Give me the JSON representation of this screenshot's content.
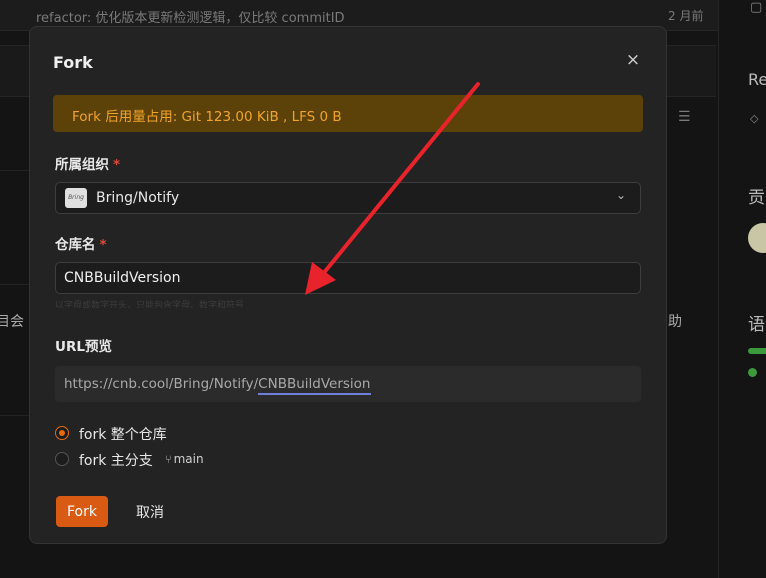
{
  "background": {
    "commit_message": "refactor: 优化版本更新检测逻辑，仅比较 commitID",
    "commit_time": "2 月前",
    "right_heading_1": "Re",
    "right_heading_2": "贡",
    "right_heading_3": "语",
    "left_fragment": "目会",
    "right_fragment": "助"
  },
  "modal": {
    "title": "Fork",
    "close_symbol": "×",
    "usage_banner": "Fork 后用量占用: Git 123.00 KiB , LFS 0 B",
    "org_label": "所属组织",
    "org_logo_text": "Bring",
    "org_value": "Bring/Notify",
    "repo_label": "仓库名",
    "repo_value": "CNBBuildVersion",
    "helper_text": "以字母或数字开头，只能包含字母、数字和符号",
    "url_label": "URL预览",
    "url_prefix": "https://cnb.cool/Bring/Notify/",
    "url_repo": "CNBBuildVersion",
    "option_full": "fork 整个仓库",
    "option_main": "fork 主分支",
    "main_branch": "main",
    "fork_button": "Fork",
    "cancel_button": "取消",
    "required_mark": "*"
  },
  "colors": {
    "accent": "#d95a12",
    "banner_bg": "#5c4209",
    "banner_text": "#f0a42a",
    "arrow": "#e8232c"
  }
}
